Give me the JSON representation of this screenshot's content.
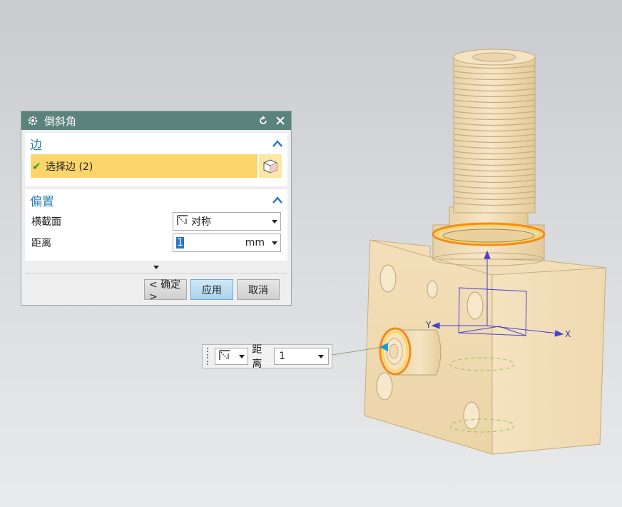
{
  "dialog": {
    "title": "倒斜角",
    "sections": {
      "edge": {
        "title": "边",
        "select_label": "选择边 (2)"
      },
      "offset": {
        "title": "偏置",
        "cross_section_label": "横截面",
        "cross_section_value": "对称",
        "distance_label": "距离",
        "distance_value": "1",
        "distance_unit": "mm"
      }
    },
    "buttons": {
      "ok": "< 确定 >",
      "apply": "应用",
      "cancel": "取消"
    }
  },
  "floating_toolbar": {
    "distance_label": "距离",
    "distance_value": "1"
  },
  "viewport": {
    "axis_x": "X",
    "axis_y": "Y"
  },
  "colors": {
    "titlebar": "#5b827b",
    "section_title": "#2b7fb3",
    "selection_highlight": "#fcd56b",
    "apply_button": "#a9d3f0",
    "part": "#f1dcb3",
    "edge_highlight": "#f28c1d",
    "csys": "#4a3fd0"
  },
  "icons": [
    "settings-gear-icon",
    "reset-icon",
    "close-icon",
    "collapse-chevron-icon",
    "check-icon",
    "cube-select-icon",
    "cross-section-icon",
    "expand-more-icon",
    "grip-handle-icon"
  ]
}
